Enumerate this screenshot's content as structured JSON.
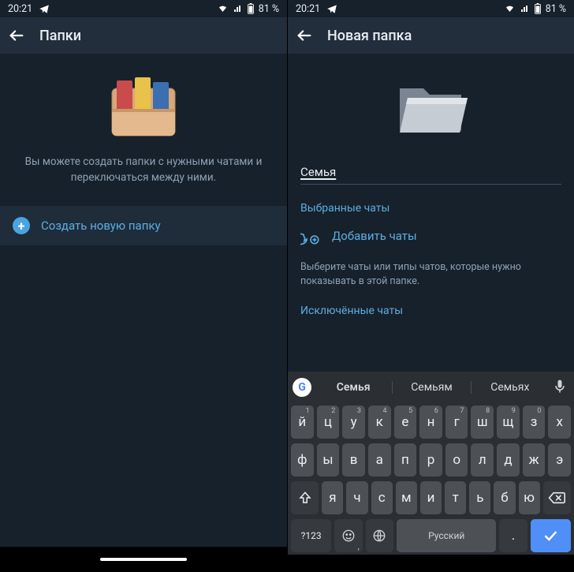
{
  "statusbar": {
    "time": "20:21",
    "battery": "81 %"
  },
  "left": {
    "title": "Папки",
    "hero_line1": "Вы можете создать папки с нужными чатами и",
    "hero_line2": "переключаться между ними.",
    "create_label": "Создать новую папку"
  },
  "right": {
    "title": "Новая папка",
    "folder_name": "Семья",
    "section1": "Выбранные чаты",
    "add_chats": "Добавить чаты",
    "hint1": "Выберите чаты или типы чатов, которые нужно",
    "hint2": "показывать в этой папке.",
    "section2": "Исключённые чаты"
  },
  "keyboard": {
    "sug1": "Семья",
    "sug2": "Семьям",
    "sug3": "Семьях",
    "row1": [
      "й",
      "ц",
      "у",
      "к",
      "е",
      "н",
      "г",
      "ш",
      "щ",
      "з",
      "х"
    ],
    "row1sup": [
      "1",
      "2",
      "3",
      "4",
      "5",
      "6",
      "7",
      "8",
      "9",
      "0",
      ""
    ],
    "row2": [
      "ф",
      "ы",
      "в",
      "а",
      "п",
      "р",
      "о",
      "л",
      "д",
      "ж",
      "э"
    ],
    "row3": [
      "я",
      "ч",
      "с",
      "м",
      "и",
      "т",
      "ь",
      "б",
      "ю"
    ],
    "numkey": "?123",
    "lang": "Русский"
  }
}
